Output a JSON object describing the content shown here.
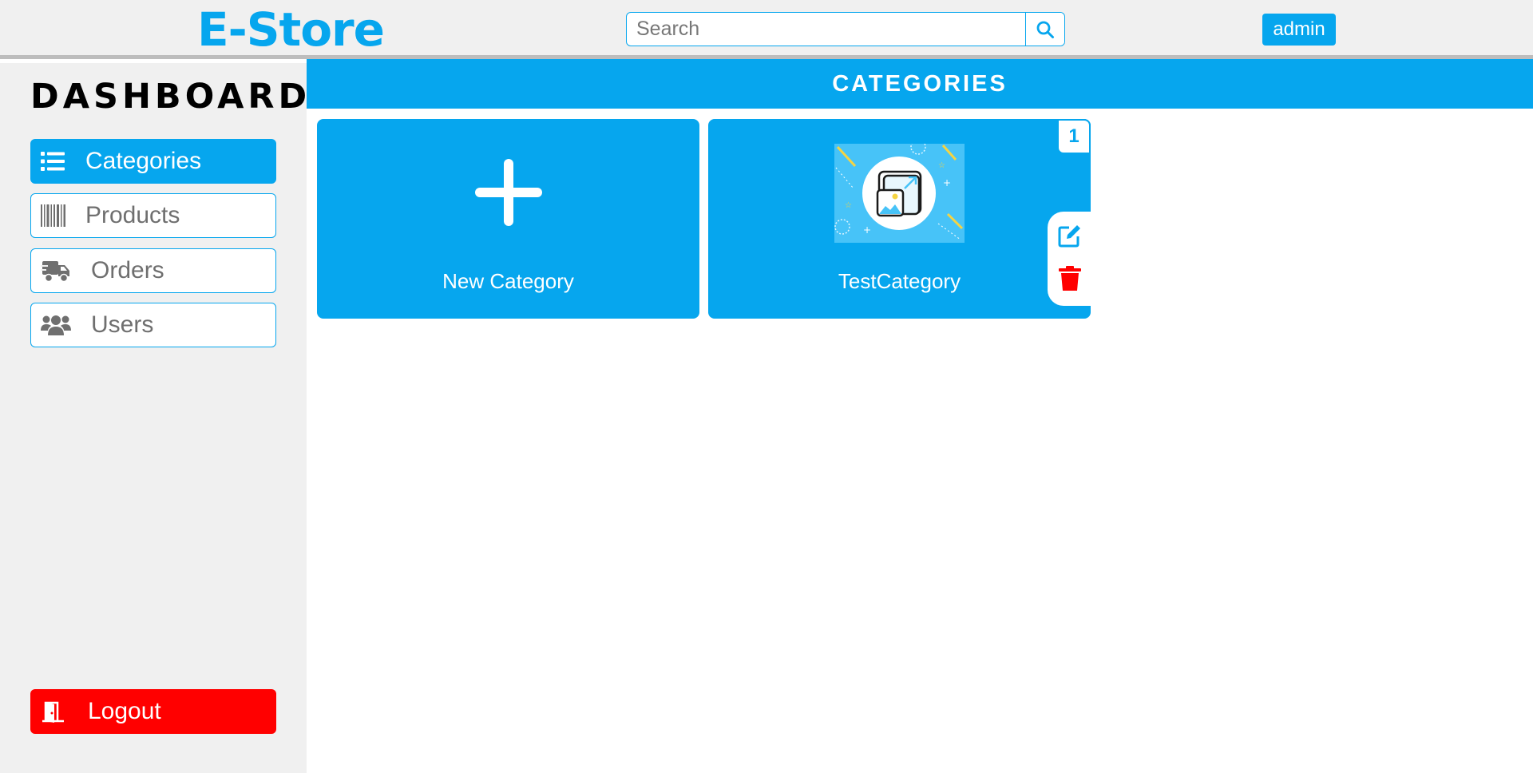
{
  "header": {
    "logo": "E-Store",
    "search_placeholder": "Search",
    "user_button": "admin"
  },
  "sidebar": {
    "title": "DASHBOARD",
    "items": [
      {
        "label": "Categories",
        "icon": "list-icon",
        "active": true
      },
      {
        "label": "Products",
        "icon": "barcode-icon",
        "active": false
      },
      {
        "label": "Orders",
        "icon": "truck-icon",
        "active": false
      },
      {
        "label": "Users",
        "icon": "users-icon",
        "active": false
      }
    ],
    "logout_label": "Logout"
  },
  "main": {
    "title": "CATEGORIES",
    "new_card_label": "New Category",
    "categories": [
      {
        "name": "TestCategory",
        "count": "1"
      }
    ]
  },
  "colors": {
    "accent": "#06a6ee",
    "danger": "#ff0000",
    "sidebar_bg": "#f0f0f0"
  }
}
